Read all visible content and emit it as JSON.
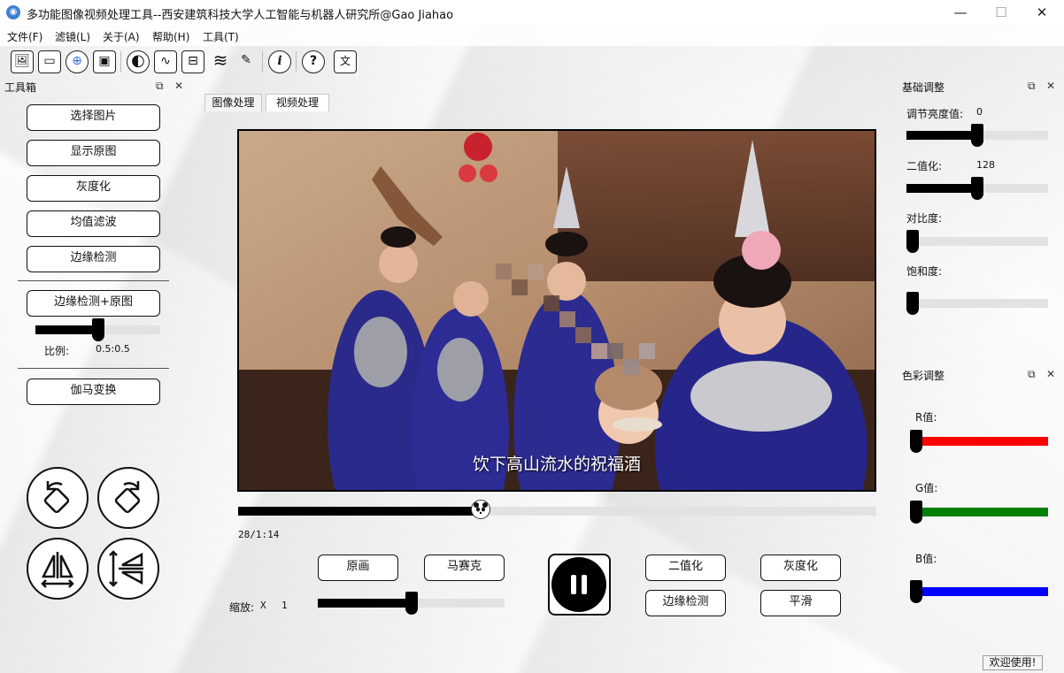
{
  "window": {
    "title": "多功能图像视频处理工具--西安建筑科技大学人工智能与机器人研究所@Gao Jiahao",
    "minimize": "—",
    "maximize": "☐",
    "close": "✕"
  },
  "menu": [
    "文件(F)",
    "滤镜(L)",
    "关于(A)",
    "帮助(H)",
    "工具(T)"
  ],
  "toolbar": [
    {
      "name": "open-image-icon",
      "glyph": "🖼"
    },
    {
      "name": "video-camera-icon",
      "glyph": "▭"
    },
    {
      "name": "zoom-icon",
      "glyph": "⊕"
    },
    {
      "name": "save-icon",
      "glyph": "▣"
    },
    {
      "name": "contrast-icon",
      "glyph": "◐"
    },
    {
      "name": "wave-icon",
      "glyph": "∿"
    },
    {
      "name": "adjust-icon",
      "glyph": "⊟"
    },
    {
      "name": "layers-icon",
      "glyph": "≋"
    },
    {
      "name": "pen-icon",
      "glyph": "✎"
    },
    {
      "name": "info-icon",
      "glyph": "i"
    },
    {
      "name": "help-icon",
      "glyph": "?"
    },
    {
      "name": "translate-icon",
      "glyph": "文"
    }
  ],
  "toolbox": {
    "title": "工具箱",
    "float": "⧉",
    "close": "✕",
    "buttons": [
      "选择图片",
      "显示原图",
      "灰度化",
      "均值滤波",
      "边缘检测"
    ],
    "edge_blend_button": "边缘检测+原图",
    "ratio_label": "比例:",
    "ratio_value": "0.5:0.5",
    "ratio_slider": 0.5,
    "gamma_button": "伽马变换"
  },
  "tabs": [
    "图像处理",
    "视频处理"
  ],
  "video": {
    "subtitle": "饮下高山流水的祝福酒",
    "time": "28/1:14",
    "progress": 0.38,
    "buttons_left": [
      "原画",
      "马赛克"
    ],
    "buttons_right_top": [
      "二值化",
      "灰度化"
    ],
    "buttons_right_bottom": [
      "边缘检测",
      "平滑"
    ],
    "zoom_label": "缩放:",
    "zoom_x": "X",
    "zoom_value": "1",
    "zoom_slider": 0.5
  },
  "basic": {
    "title": "基础调整",
    "float": "⧉",
    "close": "✕",
    "brightness_label": "调节亮度值:",
    "brightness_value": "0",
    "brightness_slider": 0.5,
    "binary_label": "二值化:",
    "binary_value": "128",
    "binary_slider": 0.5,
    "contrast_label": "对比度:",
    "contrast_slider": 0.0,
    "saturation_label": "饱和度:",
    "saturation_slider": 0.0
  },
  "color": {
    "title": "色彩调整",
    "float": "⧉",
    "close": "✕",
    "r_label": "R值:",
    "g_label": "G值:",
    "b_label": "B值:",
    "r_color": "#ff0000",
    "g_color": "#008000",
    "b_color": "#0000ff",
    "r_slider": 0.0,
    "g_slider": 0.0,
    "b_slider": 0.0
  },
  "status": "欢迎使用!"
}
